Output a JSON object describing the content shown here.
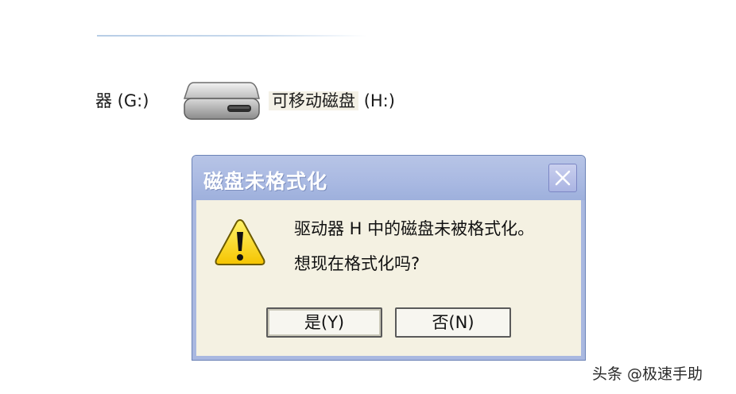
{
  "explorer": {
    "drive_g_label": "器 (G:)",
    "drive_h_label": "可移动磁盘",
    "drive_h_letter": "(H:)"
  },
  "dialog": {
    "title": "磁盘未格式化",
    "message_line1": "驱动器 H 中的磁盘未被格式化。",
    "message_line2": "想现在格式化吗?",
    "yes_label": "是(Y)",
    "no_label": "否(N)"
  },
  "watermark": "头条 @极速手助",
  "colors": {
    "titlebar": "#a9b9e2",
    "dialog_bg": "#f4f1e2",
    "warning_yellow": "#ffd800"
  },
  "icons": {
    "drive": "removable-disk-icon",
    "warning": "warning-icon",
    "close": "close-icon"
  }
}
